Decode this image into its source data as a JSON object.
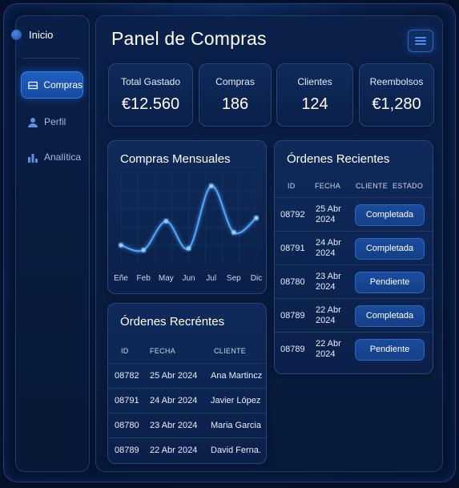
{
  "sidebar": {
    "brand_label": "Inicio",
    "items": [
      {
        "label": "Compras",
        "active": true,
        "icon": "cart-icon"
      },
      {
        "label": "Perfil",
        "active": false,
        "icon": "user-icon"
      },
      {
        "label": "Analítica",
        "active": false,
        "icon": "bar-chart-icon"
      }
    ]
  },
  "header": {
    "title": "Panel de Compras",
    "menu_icon": "hamburger-menu-icon"
  },
  "stats": [
    {
      "label": "Total Gastado",
      "value": "€12.560"
    },
    {
      "label": "Compras",
      "value": "186"
    },
    {
      "label": "Clientes",
      "value": "124"
    },
    {
      "label": "Reembolsos",
      "value": "€1,280"
    }
  ],
  "chart_card": {
    "title": "Compras Mensuales"
  },
  "chart_data": {
    "type": "line",
    "title": "Compras Mensuales",
    "categories": [
      "Eñe",
      "Feb",
      "May",
      "Jun",
      "Jul",
      "Sep",
      "Dic"
    ],
    "values": [
      18,
      12,
      48,
      14,
      92,
      34,
      52
    ],
    "ylim": [
      0,
      100
    ],
    "grid": true,
    "color": "#4fa8ff"
  },
  "recent_orders_bottom": {
    "title": "Órdenes Recréntes",
    "columns": [
      "ID",
      "FECHA",
      "CLIENTE"
    ],
    "rows": [
      {
        "id": "08782",
        "date": "25 Abr 2024",
        "client": "Ana Martincz"
      },
      {
        "id": "08791",
        "date": "24 Abr 2024",
        "client": "Javier López"
      },
      {
        "id": "08780",
        "date": "23 Abr 2024",
        "client": "Maria Garcia"
      },
      {
        "id": "08789",
        "date": "22 Abr 2024",
        "client": "David Ferna."
      }
    ]
  },
  "recent_orders_right": {
    "title": "Órdenes Recientes",
    "columns": [
      "ID",
      "FECHA",
      "CLIENTE",
      "ESTADO"
    ],
    "rows": [
      {
        "id": "08792",
        "date_line1": "25 Abr",
        "date_line2": "2024",
        "status": "Completada"
      },
      {
        "id": "08791",
        "date_line1": "24 Abr",
        "date_line2": "2024",
        "status": "Completada"
      },
      {
        "id": "08780",
        "date_line1": "23 Abr",
        "date_line2": "2024",
        "status": "Pendiente"
      },
      {
        "id": "08789",
        "date_line1": "22 Abr",
        "date_line2": "2024",
        "status": "Completada"
      },
      {
        "id": "08789",
        "date_line1": "22 Abr",
        "date_line2": "2024",
        "status": "Pendiente"
      }
    ]
  }
}
